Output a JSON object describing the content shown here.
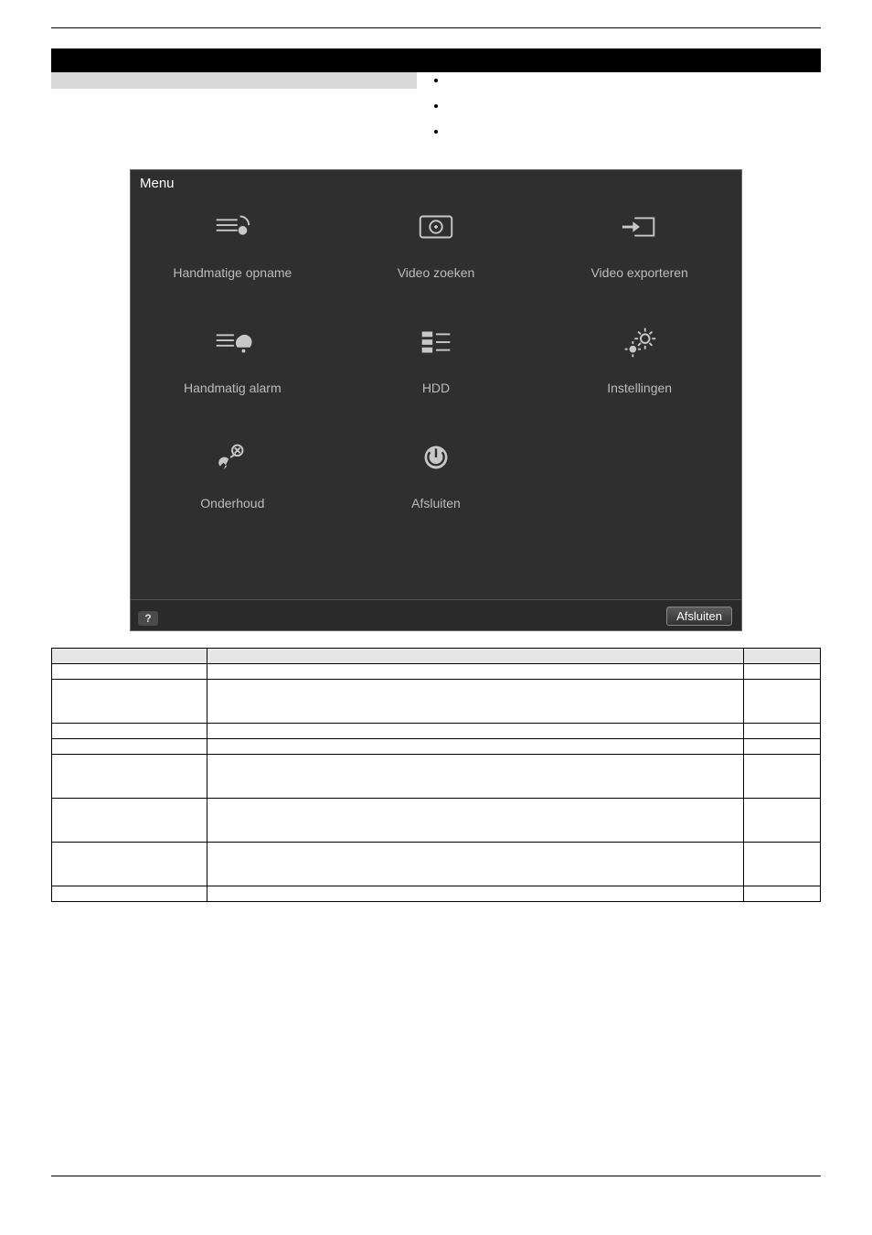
{
  "header": {
    "left": "",
    "right": ""
  },
  "bullets": [
    "",
    "",
    ""
  ],
  "screenshot": {
    "title": "Menu",
    "items": [
      {
        "label": "Handmatige opname"
      },
      {
        "label": "Video zoeken"
      },
      {
        "label": "Video exporteren"
      },
      {
        "label": "Handmatig alarm"
      },
      {
        "label": "HDD"
      },
      {
        "label": "Instellingen"
      },
      {
        "label": "Onderhoud"
      },
      {
        "label": "Afsluiten"
      }
    ],
    "help_glyph": "?",
    "exit_label": "Afsluiten"
  },
  "table": {
    "headers": [
      "",
      "",
      ""
    ],
    "rows": [
      {
        "c1": "",
        "c2": "",
        "c3": "",
        "tall": false
      },
      {
        "c1": "",
        "c2": "",
        "c3": "",
        "tall": true
      },
      {
        "c1": "",
        "c2": "",
        "c3": "",
        "tall": false
      },
      {
        "c1": "",
        "c2": "",
        "c3": "",
        "tall": false
      },
      {
        "c1": "",
        "c2": "",
        "c3": "",
        "tall": true
      },
      {
        "c1": "",
        "c2": "",
        "c3": "",
        "tall": true
      },
      {
        "c1": "",
        "c2": "",
        "c3": "",
        "tall": true
      },
      {
        "c1": "",
        "c2": "",
        "c3": "",
        "tall": false
      }
    ]
  },
  "footer": {
    "left": "",
    "right": ""
  }
}
